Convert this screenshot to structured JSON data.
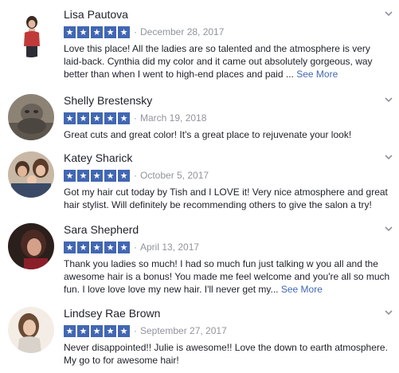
{
  "reviews": [
    {
      "name": "Lisa Pautova",
      "date": "December 28, 2017",
      "text": "Love this place! All the ladies are so talented and the atmosphere is very laid-back. Cynthia did my color and it came out absolutely gorgeous, way better than when I went to high-end places and paid ...",
      "see_more": "See More",
      "avatar_icon": "avatar-photo"
    },
    {
      "name": "Shelly Brestensky",
      "date": "March 19, 2018",
      "text": "Great cuts and great color! It's a great place to rejuvenate your look!",
      "see_more": "",
      "avatar_icon": "avatar-photo"
    },
    {
      "name": "Katey Sharick",
      "date": "October 5, 2017",
      "text": "Got my hair cut today by Tish and I LOVE it! Very nice atmosphere and great hair stylist. Will definitely be recommending others to give the salon a try!",
      "see_more": "",
      "avatar_icon": "avatar-photo"
    },
    {
      "name": "Sara Shepherd",
      "date": "April 13, 2017",
      "text": "Thank you ladies so much! I had so much fun just talking w you all and the awesome hair is a bonus! You made me feel welcome and you're all so much fun. I love love love my new hair. I'll never get my...",
      "see_more": "See More",
      "avatar_icon": "avatar-photo"
    },
    {
      "name": "Lindsey Rae Brown",
      "date": "September 27, 2017",
      "text": "Never disappointed!! Julie is awesome!! Love the down to earth atmosphere. My go to for awesome hair!",
      "see_more": "",
      "avatar_icon": "avatar-photo"
    }
  ],
  "rating": {
    "stars": 5,
    "max": 5
  },
  "separator": "·",
  "icons": {
    "star": "star-icon",
    "options": "chevron-down-icon"
  },
  "colors": {
    "star_bg": "#4267b2",
    "link": "#4267b2",
    "muted": "#90949c",
    "text": "#1d2129"
  }
}
